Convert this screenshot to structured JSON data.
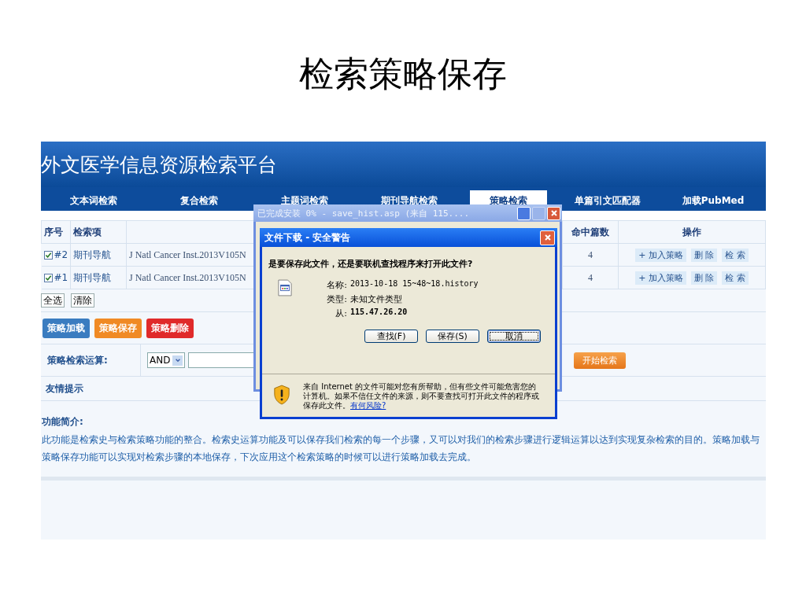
{
  "slide_title": "检索策略保存",
  "site": {
    "title": "外文医学信息资源检索平台"
  },
  "nav": [
    {
      "label": "文本词检索",
      "selected": false
    },
    {
      "label": "复合检索",
      "selected": false
    },
    {
      "label": "主题词检索",
      "selected": false
    },
    {
      "label": "期刊导航检索",
      "selected": false
    },
    {
      "label": "策略检索",
      "selected": true
    },
    {
      "label": "单篇引文匹配器",
      "selected": false
    },
    {
      "label": "加载PubMed",
      "selected": false
    }
  ],
  "table": {
    "columns": [
      "序号",
      "检索项",
      "命中篇数",
      "操作"
    ],
    "rows": [
      {
        "checked": true,
        "number": "#2",
        "item": "期刊导航",
        "column_3": "J Natl Cancer Inst.2013V105N",
        "hits": "4",
        "actions": [
          "+ 加入策略",
          "删 除",
          "检 索"
        ]
      },
      {
        "checked": true,
        "number": "#1",
        "item": "期刊导航",
        "column_3": "J Natl Cancer Inst.2013V105N",
        "hits": "4",
        "actions": [
          "+ 加入策略",
          "删 除",
          "检 索"
        ]
      }
    ]
  },
  "selection_buttons": [
    "全选",
    "清除"
  ],
  "strategy_buttons": [
    {
      "label": "策略加载",
      "kind": "load"
    },
    {
      "label": "策略保存",
      "kind": "save"
    },
    {
      "label": "策略删除",
      "kind": "delete"
    }
  ],
  "strategy_query": {
    "label": "策略检索运算:",
    "operator": "AND",
    "button": "开始检索"
  },
  "tips": {
    "heading": "友情提示",
    "subheading": "功能简介:",
    "text": "此功能是检索史与检索策略功能的整合。检索史运算功能及可以保存我们检索的每一个步骤，又可以对我们的检索步骤进行逻辑运算以达到实现复杂检索的目的。策略加载与策略保存功能可以实现对检索步骤的本地保存，下次应用这个检索策略的时候可以进行策略加载去完成。"
  },
  "download_progress": {
    "title": "已完成安装 0% - save_hist.asp (来自 115...."
  },
  "file_download": {
    "title": "文件下载 - 安全警告",
    "question": "是要保存此文件，还是要联机查找程序来打开此文件?",
    "fields": [
      {
        "label": "名称:",
        "value": "2013-10-18 15~48~18.history",
        "bold": false
      },
      {
        "label": "类型:",
        "value": "未知文件类型",
        "bold": false
      },
      {
        "label": "从:",
        "value": "115.47.26.20",
        "bold": true
      }
    ],
    "buttons": [
      {
        "label": "查找(F)",
        "selected": false
      },
      {
        "label": "保存(S)",
        "selected": false
      },
      {
        "label": "取消",
        "selected": true
      }
    ],
    "warning": "来自 Internet 的文件可能对您有所帮助，但有些文件可能危害您的计算机。如果不信任文件的来源，则不要查找可打开此文件的程序或保存此文件。",
    "link": "有何风险?"
  }
}
